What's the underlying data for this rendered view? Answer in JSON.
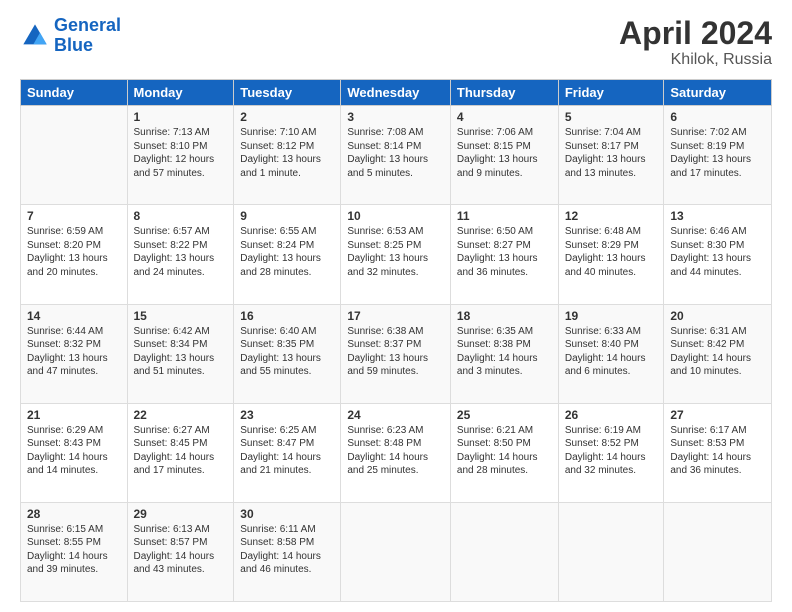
{
  "logo": {
    "line1": "General",
    "line2": "Blue"
  },
  "title": "April 2024",
  "subtitle": "Khilok, Russia",
  "days": [
    "Sunday",
    "Monday",
    "Tuesday",
    "Wednesday",
    "Thursday",
    "Friday",
    "Saturday"
  ],
  "weeks": [
    [
      {
        "date": "",
        "sunrise": "",
        "sunset": "",
        "daylight": ""
      },
      {
        "date": "1",
        "sunrise": "Sunrise: 7:13 AM",
        "sunset": "Sunset: 8:10 PM",
        "daylight": "Daylight: 12 hours and 57 minutes."
      },
      {
        "date": "2",
        "sunrise": "Sunrise: 7:10 AM",
        "sunset": "Sunset: 8:12 PM",
        "daylight": "Daylight: 13 hours and 1 minute."
      },
      {
        "date": "3",
        "sunrise": "Sunrise: 7:08 AM",
        "sunset": "Sunset: 8:14 PM",
        "daylight": "Daylight: 13 hours and 5 minutes."
      },
      {
        "date": "4",
        "sunrise": "Sunrise: 7:06 AM",
        "sunset": "Sunset: 8:15 PM",
        "daylight": "Daylight: 13 hours and 9 minutes."
      },
      {
        "date": "5",
        "sunrise": "Sunrise: 7:04 AM",
        "sunset": "Sunset: 8:17 PM",
        "daylight": "Daylight: 13 hours and 13 minutes."
      },
      {
        "date": "6",
        "sunrise": "Sunrise: 7:02 AM",
        "sunset": "Sunset: 8:19 PM",
        "daylight": "Daylight: 13 hours and 17 minutes."
      }
    ],
    [
      {
        "date": "7",
        "sunrise": "Sunrise: 6:59 AM",
        "sunset": "Sunset: 8:20 PM",
        "daylight": "Daylight: 13 hours and 20 minutes."
      },
      {
        "date": "8",
        "sunrise": "Sunrise: 6:57 AM",
        "sunset": "Sunset: 8:22 PM",
        "daylight": "Daylight: 13 hours and 24 minutes."
      },
      {
        "date": "9",
        "sunrise": "Sunrise: 6:55 AM",
        "sunset": "Sunset: 8:24 PM",
        "daylight": "Daylight: 13 hours and 28 minutes."
      },
      {
        "date": "10",
        "sunrise": "Sunrise: 6:53 AM",
        "sunset": "Sunset: 8:25 PM",
        "daylight": "Daylight: 13 hours and 32 minutes."
      },
      {
        "date": "11",
        "sunrise": "Sunrise: 6:50 AM",
        "sunset": "Sunset: 8:27 PM",
        "daylight": "Daylight: 13 hours and 36 minutes."
      },
      {
        "date": "12",
        "sunrise": "Sunrise: 6:48 AM",
        "sunset": "Sunset: 8:29 PM",
        "daylight": "Daylight: 13 hours and 40 minutes."
      },
      {
        "date": "13",
        "sunrise": "Sunrise: 6:46 AM",
        "sunset": "Sunset: 8:30 PM",
        "daylight": "Daylight: 13 hours and 44 minutes."
      }
    ],
    [
      {
        "date": "14",
        "sunrise": "Sunrise: 6:44 AM",
        "sunset": "Sunset: 8:32 PM",
        "daylight": "Daylight: 13 hours and 47 minutes."
      },
      {
        "date": "15",
        "sunrise": "Sunrise: 6:42 AM",
        "sunset": "Sunset: 8:34 PM",
        "daylight": "Daylight: 13 hours and 51 minutes."
      },
      {
        "date": "16",
        "sunrise": "Sunrise: 6:40 AM",
        "sunset": "Sunset: 8:35 PM",
        "daylight": "Daylight: 13 hours and 55 minutes."
      },
      {
        "date": "17",
        "sunrise": "Sunrise: 6:38 AM",
        "sunset": "Sunset: 8:37 PM",
        "daylight": "Daylight: 13 hours and 59 minutes."
      },
      {
        "date": "18",
        "sunrise": "Sunrise: 6:35 AM",
        "sunset": "Sunset: 8:38 PM",
        "daylight": "Daylight: 14 hours and 3 minutes."
      },
      {
        "date": "19",
        "sunrise": "Sunrise: 6:33 AM",
        "sunset": "Sunset: 8:40 PM",
        "daylight": "Daylight: 14 hours and 6 minutes."
      },
      {
        "date": "20",
        "sunrise": "Sunrise: 6:31 AM",
        "sunset": "Sunset: 8:42 PM",
        "daylight": "Daylight: 14 hours and 10 minutes."
      }
    ],
    [
      {
        "date": "21",
        "sunrise": "Sunrise: 6:29 AM",
        "sunset": "Sunset: 8:43 PM",
        "daylight": "Daylight: 14 hours and 14 minutes."
      },
      {
        "date": "22",
        "sunrise": "Sunrise: 6:27 AM",
        "sunset": "Sunset: 8:45 PM",
        "daylight": "Daylight: 14 hours and 17 minutes."
      },
      {
        "date": "23",
        "sunrise": "Sunrise: 6:25 AM",
        "sunset": "Sunset: 8:47 PM",
        "daylight": "Daylight: 14 hours and 21 minutes."
      },
      {
        "date": "24",
        "sunrise": "Sunrise: 6:23 AM",
        "sunset": "Sunset: 8:48 PM",
        "daylight": "Daylight: 14 hours and 25 minutes."
      },
      {
        "date": "25",
        "sunrise": "Sunrise: 6:21 AM",
        "sunset": "Sunset: 8:50 PM",
        "daylight": "Daylight: 14 hours and 28 minutes."
      },
      {
        "date": "26",
        "sunrise": "Sunrise: 6:19 AM",
        "sunset": "Sunset: 8:52 PM",
        "daylight": "Daylight: 14 hours and 32 minutes."
      },
      {
        "date": "27",
        "sunrise": "Sunrise: 6:17 AM",
        "sunset": "Sunset: 8:53 PM",
        "daylight": "Daylight: 14 hours and 36 minutes."
      }
    ],
    [
      {
        "date": "28",
        "sunrise": "Sunrise: 6:15 AM",
        "sunset": "Sunset: 8:55 PM",
        "daylight": "Daylight: 14 hours and 39 minutes."
      },
      {
        "date": "29",
        "sunrise": "Sunrise: 6:13 AM",
        "sunset": "Sunset: 8:57 PM",
        "daylight": "Daylight: 14 hours and 43 minutes."
      },
      {
        "date": "30",
        "sunrise": "Sunrise: 6:11 AM",
        "sunset": "Sunset: 8:58 PM",
        "daylight": "Daylight: 14 hours and 46 minutes."
      },
      {
        "date": "",
        "sunrise": "",
        "sunset": "",
        "daylight": ""
      },
      {
        "date": "",
        "sunrise": "",
        "sunset": "",
        "daylight": ""
      },
      {
        "date": "",
        "sunrise": "",
        "sunset": "",
        "daylight": ""
      },
      {
        "date": "",
        "sunrise": "",
        "sunset": "",
        "daylight": ""
      }
    ]
  ]
}
